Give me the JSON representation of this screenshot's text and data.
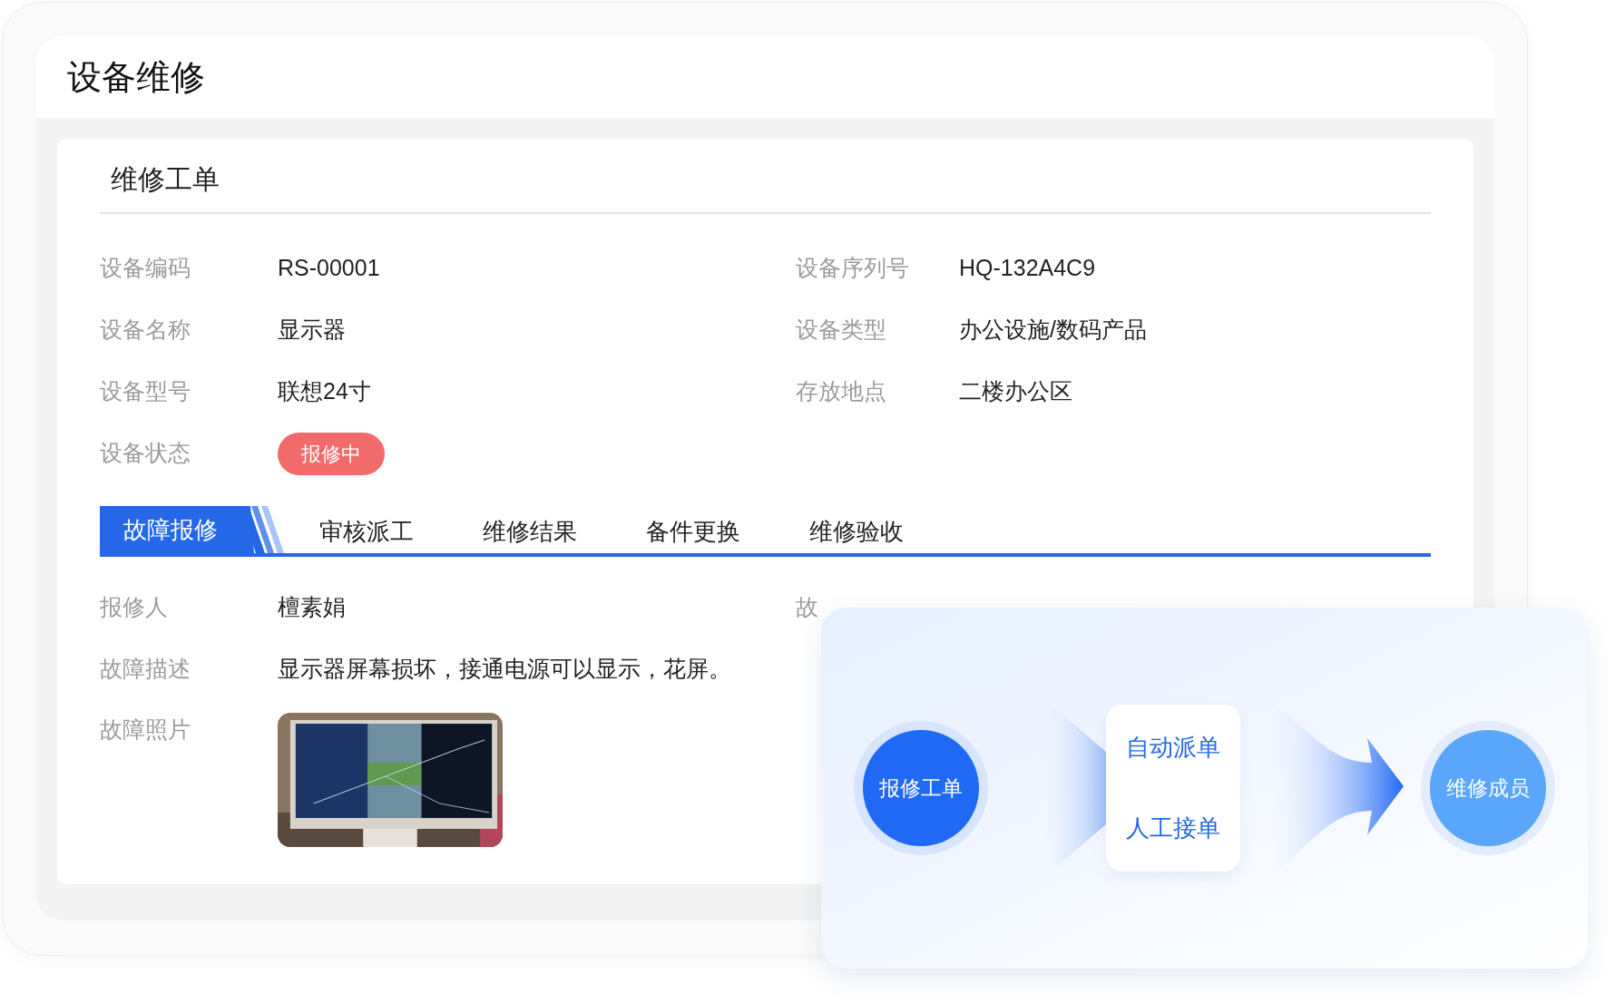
{
  "page_title": "设备维修",
  "card_title": "维修工单",
  "fields": [
    {
      "label": "设备编码",
      "value": "RS-00001"
    },
    {
      "label": "设备序列号",
      "value": "HQ-132A4C9"
    },
    {
      "label": "设备名称",
      "value": "显示器"
    },
    {
      "label": "设备类型",
      "value": "办公设施/数码产品"
    },
    {
      "label": "设备型号",
      "value": "联想24寸"
    },
    {
      "label": "存放地点",
      "value": "二楼办公区"
    }
  ],
  "status": {
    "label": "设备状态",
    "value": "报修中",
    "color": "#f26b6b"
  },
  "tabs": [
    {
      "label": "故障报修",
      "selected": true
    },
    {
      "label": "审核派工",
      "selected": false
    },
    {
      "label": "维修结果",
      "selected": false
    },
    {
      "label": "备件更换",
      "selected": false
    },
    {
      "label": "维修验收",
      "selected": false
    }
  ],
  "fault": {
    "reporter_label": "报修人",
    "reporter": "檀素娟",
    "partial_label": "故",
    "desc_label": "故障描述",
    "desc": "显示器屏幕损坏，接通电源可以显示，花屏。",
    "photo_label": "故障照片"
  },
  "flow": {
    "source": "报修工单",
    "options": [
      "自动派单",
      "人工接单"
    ],
    "target": "维修成员"
  }
}
